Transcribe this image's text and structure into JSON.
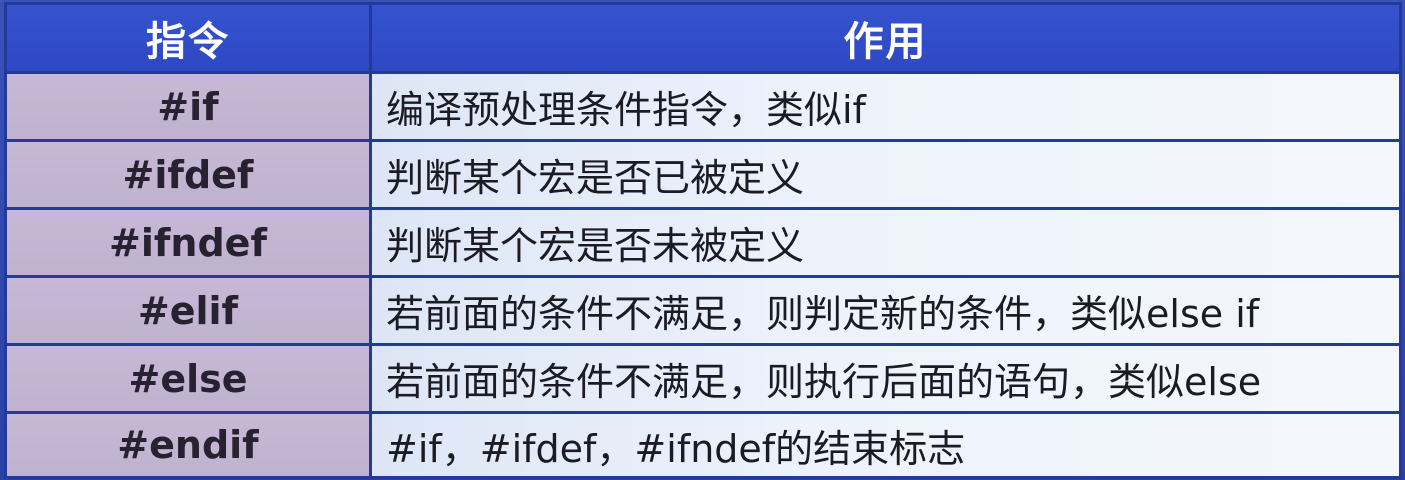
{
  "table": {
    "headers": [
      "指令",
      "作用"
    ],
    "rows": [
      {
        "directive": "#if",
        "purpose": "编译预处理条件指令，类似if"
      },
      {
        "directive": "#ifdef",
        "purpose": "判断某个宏是否已被定义"
      },
      {
        "directive": "#ifndef",
        "purpose": "判断某个宏是否未被定义"
      },
      {
        "directive": "#elif",
        "purpose": "若前面的条件不满足，则判定新的条件，类似else if"
      },
      {
        "directive": "#else",
        "purpose": "若前面的条件不满足，则执行后面的语句，类似else"
      },
      {
        "directive": "#endif",
        "purpose": "#if，#ifdef，#ifndef的结束标志"
      }
    ]
  },
  "colors": {
    "header_bg": "#3553cf",
    "directive_bg": "#c7b8d6",
    "purpose_bg": "#eef3fb",
    "border": "#243a98"
  }
}
